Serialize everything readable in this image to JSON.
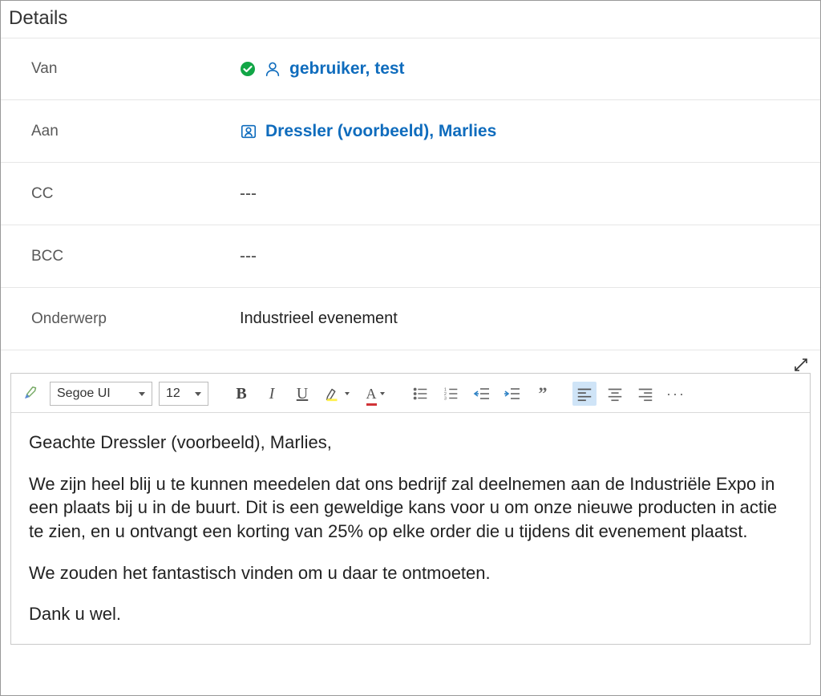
{
  "header": {
    "title": "Details"
  },
  "fields": {
    "from": {
      "label": "Van",
      "value": "gebruiker, test"
    },
    "to": {
      "label": "Aan",
      "value": "Dressler (voorbeeld), Marlies"
    },
    "cc": {
      "label": "CC",
      "value": "---"
    },
    "bcc": {
      "label": "BCC",
      "value": "---"
    },
    "subject": {
      "label": "Onderwerp",
      "value": "Industrieel evenement"
    }
  },
  "toolbar": {
    "font": "Segoe UI",
    "size": "12",
    "quote": "”"
  },
  "body": {
    "p1": "Geachte Dressler (voorbeeld), Marlies,",
    "p2": "We zijn heel blij u te kunnen meedelen dat ons bedrijf zal deelnemen aan de Industriële Expo in een plaats bij u in de buurt. Dit is een geweldige kans voor u om onze nieuwe producten in actie te zien, en u ontvangt een korting van 25% op elke order die u tijdens dit evenement plaatst.",
    "p3": "We zouden het fantastisch vinden om u daar te ontmoeten.",
    "p4": "Dank u wel."
  }
}
